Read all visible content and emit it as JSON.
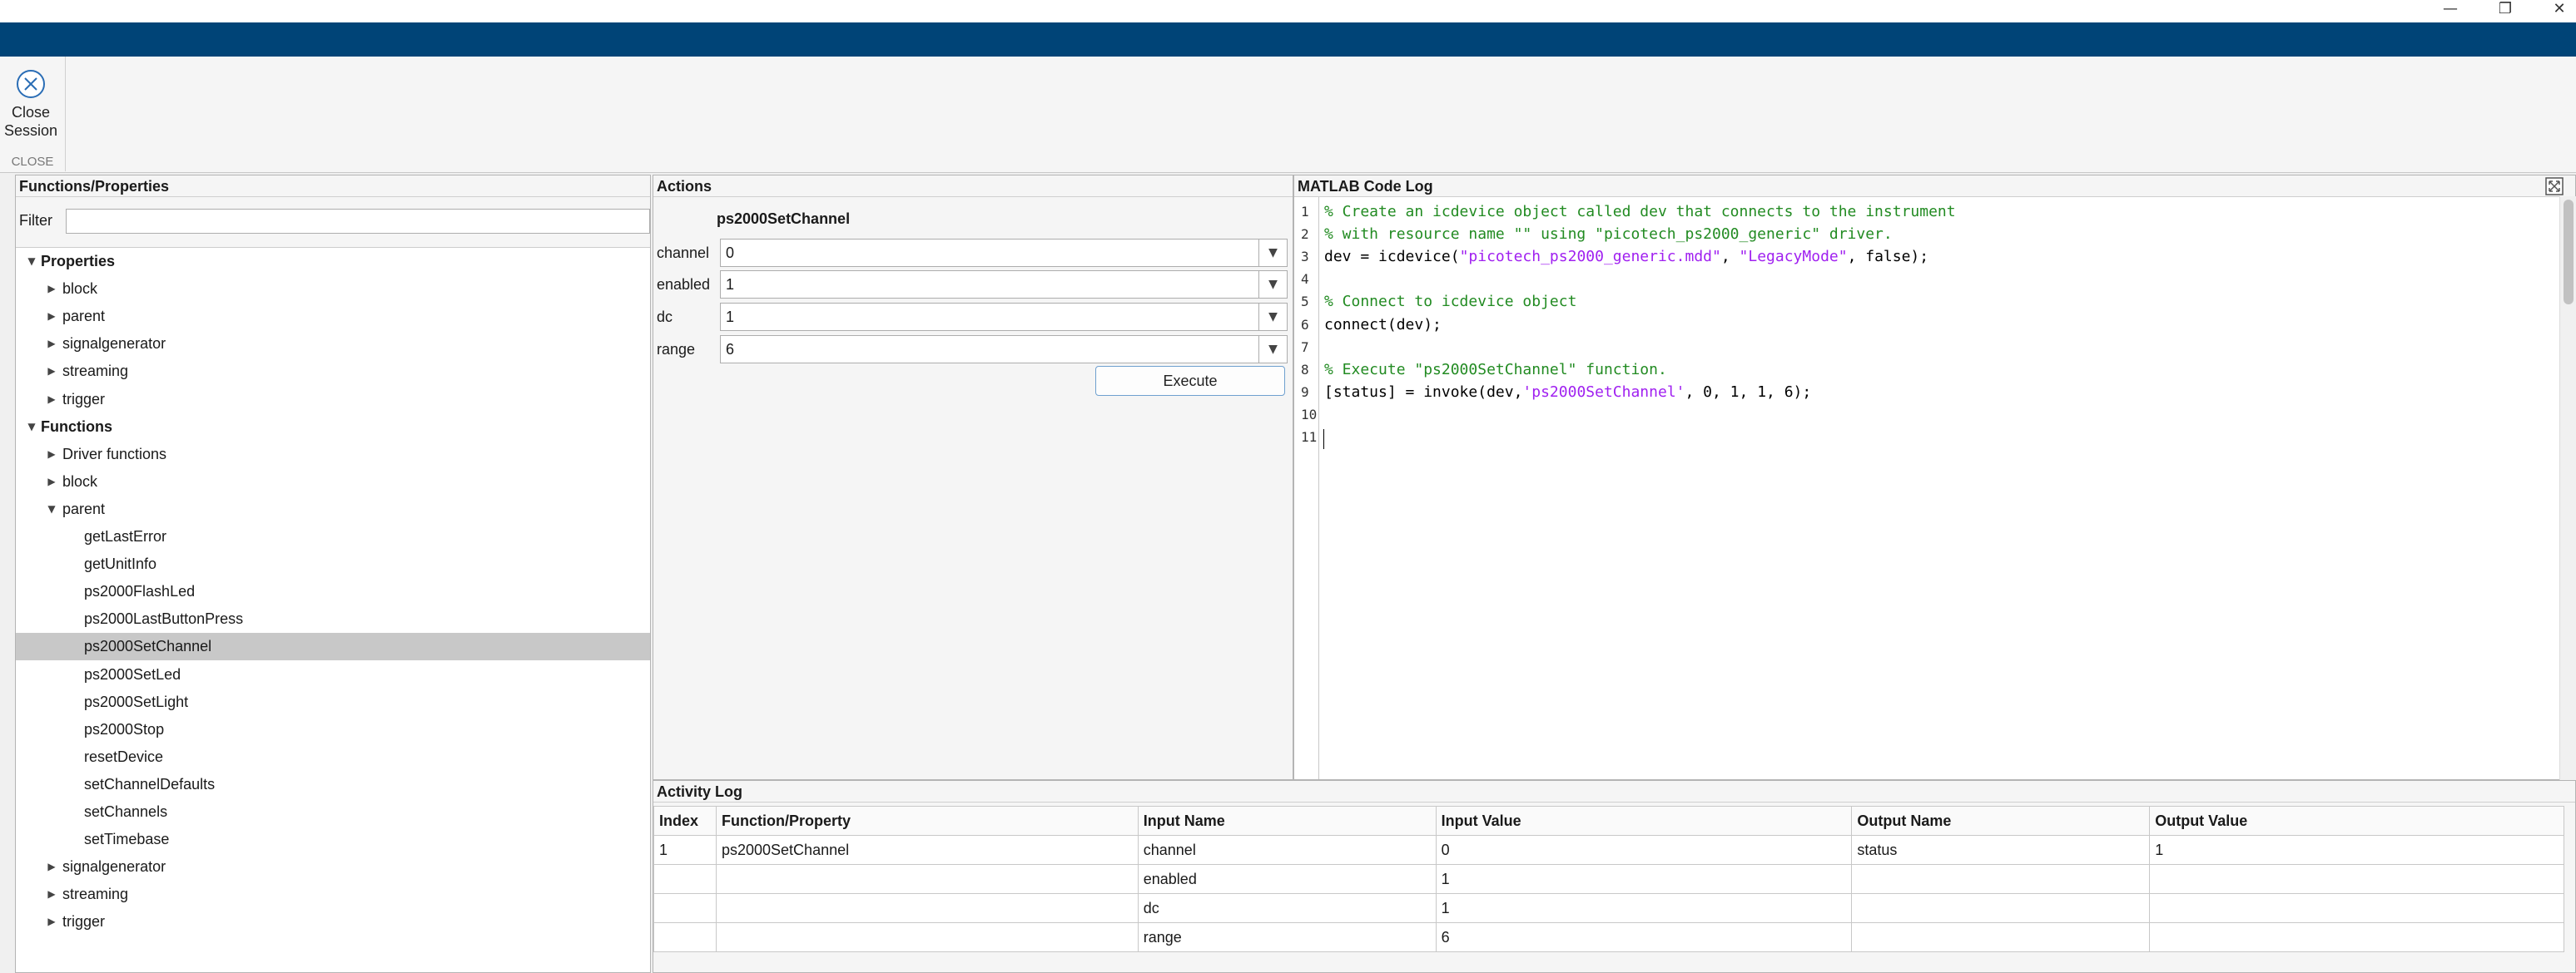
{
  "window": {
    "minimize_glyph": "—",
    "restore_glyph": "❐",
    "close_glyph": "✕"
  },
  "toolstrip": {
    "close_session_line1": "Close",
    "close_session_line2": "Session",
    "section_label": "CLOSE"
  },
  "functions_panel": {
    "title": "Functions/Properties",
    "filter_label": "Filter",
    "filter_value": "",
    "tree": [
      {
        "label": "Properties",
        "level": 0,
        "arrow": "▼",
        "bold": true
      },
      {
        "label": "block",
        "level": 1,
        "arrow": "▶"
      },
      {
        "label": "parent",
        "level": 1,
        "arrow": "▶"
      },
      {
        "label": "signalgenerator",
        "level": 1,
        "arrow": "▶"
      },
      {
        "label": "streaming",
        "level": 1,
        "arrow": "▶"
      },
      {
        "label": "trigger",
        "level": 1,
        "arrow": "▶"
      },
      {
        "label": "Functions",
        "level": 0,
        "arrow": "▼",
        "bold": true
      },
      {
        "label": "Driver functions",
        "level": 1,
        "arrow": "▶"
      },
      {
        "label": "block",
        "level": 1,
        "arrow": "▶"
      },
      {
        "label": "parent",
        "level": 1,
        "arrow": "▼"
      },
      {
        "label": "getLastError",
        "level": 2
      },
      {
        "label": "getUnitInfo",
        "level": 2
      },
      {
        "label": "ps2000FlashLed",
        "level": 2
      },
      {
        "label": "ps2000LastButtonPress",
        "level": 2
      },
      {
        "label": "ps2000SetChannel",
        "level": 2,
        "selected": true
      },
      {
        "label": "ps2000SetLed",
        "level": 2
      },
      {
        "label": "ps2000SetLight",
        "level": 2
      },
      {
        "label": "ps2000Stop",
        "level": 2
      },
      {
        "label": "resetDevice",
        "level": 2
      },
      {
        "label": "setChannelDefaults",
        "level": 2
      },
      {
        "label": "setChannels",
        "level": 2
      },
      {
        "label": "setTimebase",
        "level": 2
      },
      {
        "label": "signalgenerator",
        "level": 1,
        "arrow": "▶"
      },
      {
        "label": "streaming",
        "level": 1,
        "arrow": "▶"
      },
      {
        "label": "trigger",
        "level": 1,
        "arrow": "▶"
      }
    ]
  },
  "actions_panel": {
    "title": "Actions",
    "function_name": "ps2000SetChannel",
    "params": [
      {
        "label": "channel",
        "value": "0"
      },
      {
        "label": "enabled",
        "value": "1"
      },
      {
        "label": "dc",
        "value": "1"
      },
      {
        "label": "range",
        "value": "6"
      }
    ],
    "dropdown_glyph": "▼",
    "execute_label": "Execute"
  },
  "code_panel": {
    "title": "MATLAB Code Log",
    "lines": [
      {
        "n": "1",
        "parts": [
          {
            "t": "% Create an icdevice object called dev that connects to the instrument",
            "c": "c-cmt"
          }
        ]
      },
      {
        "n": "2",
        "parts": [
          {
            "t": "% with resource name \"\" using \"picotech_ps2000_generic\" driver.",
            "c": "c-cmt"
          }
        ]
      },
      {
        "n": "3",
        "parts": [
          {
            "t": "dev = icdevice(",
            "c": "c-txt"
          },
          {
            "t": "\"picotech_ps2000_generic.mdd\"",
            "c": "c-str"
          },
          {
            "t": ", ",
            "c": "c-txt"
          },
          {
            "t": "\"LegacyMode\"",
            "c": "c-str"
          },
          {
            "t": ", false);",
            "c": "c-txt"
          }
        ]
      },
      {
        "n": "4",
        "parts": []
      },
      {
        "n": "5",
        "parts": [
          {
            "t": "% Connect to icdevice object",
            "c": "c-cmt"
          }
        ]
      },
      {
        "n": "6",
        "parts": [
          {
            "t": "connect(dev);",
            "c": "c-txt"
          }
        ]
      },
      {
        "n": "7",
        "parts": []
      },
      {
        "n": "8",
        "parts": [
          {
            "t": "% Execute \"ps2000SetChannel\" function.",
            "c": "c-cmt"
          }
        ]
      },
      {
        "n": "9",
        "parts": [
          {
            "t": "[status] = invoke(dev,",
            "c": "c-txt"
          },
          {
            "t": "'ps2000SetChannel'",
            "c": "c-str"
          },
          {
            "t": ", 0, 1, 1, 6);",
            "c": "c-txt"
          }
        ]
      },
      {
        "n": "10",
        "parts": []
      },
      {
        "n": "11",
        "parts": []
      }
    ]
  },
  "activity_log": {
    "title": "Activity Log",
    "columns": [
      "Index",
      "Function/Property",
      "Input Name",
      "Input Value",
      "Output Name",
      "Output Value"
    ],
    "rows": [
      [
        "1",
        "ps2000SetChannel",
        "channel",
        "0",
        "status",
        "1"
      ],
      [
        "",
        "",
        "enabled",
        "1",
        "",
        ""
      ],
      [
        "",
        "",
        "dc",
        "1",
        "",
        ""
      ],
      [
        "",
        "",
        "range",
        "6",
        "",
        ""
      ]
    ]
  },
  "colors": {
    "title_band": "#004477",
    "selection": "#c8c8c8",
    "comment": "#228b22",
    "string": "#a020f0"
  }
}
